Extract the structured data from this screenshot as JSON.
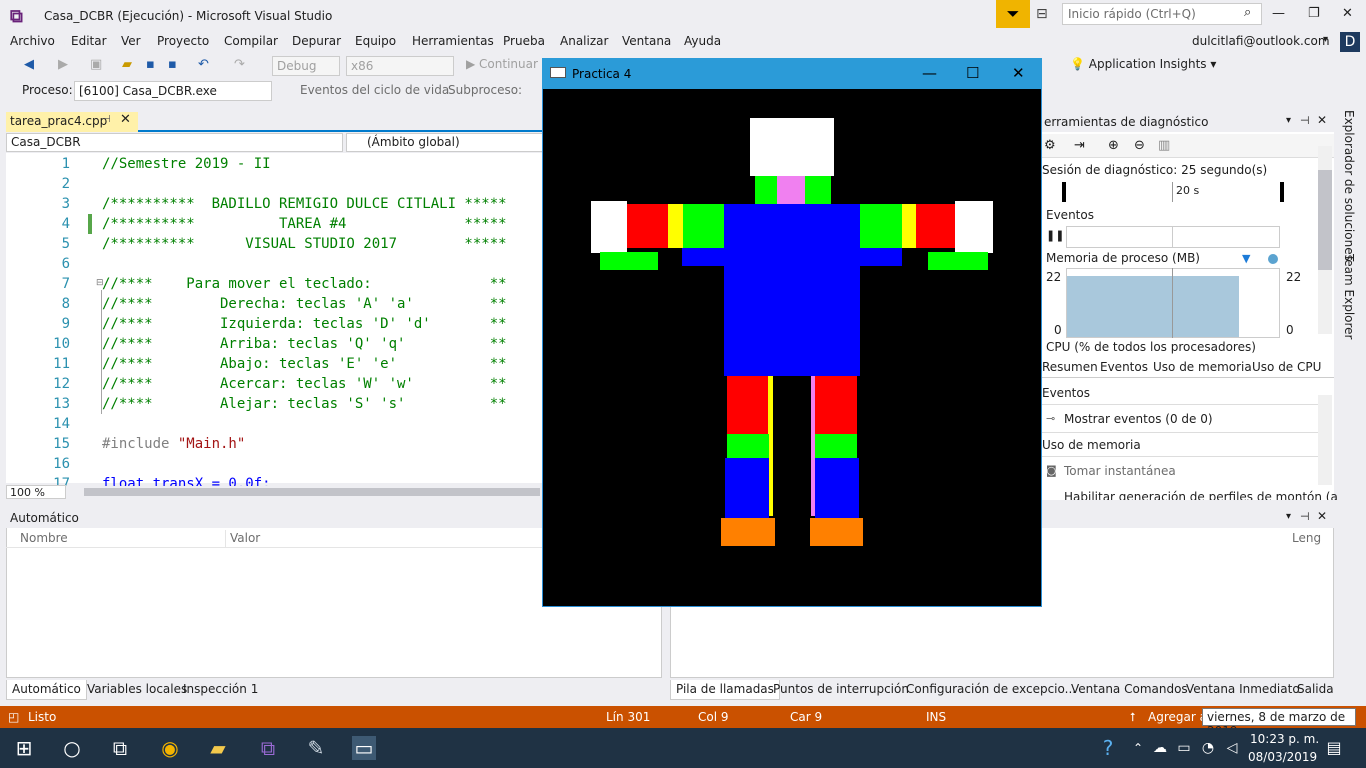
{
  "title_bar": {
    "title": "Casa_DCBR (Ejecución) - Microsoft Visual Studio",
    "quick_launch_placeholder": "Inicio rápido (Ctrl+Q)",
    "logo_glyph": "⧉",
    "notif_glyph": "⏷",
    "min_glyph": "—",
    "max_glyph": "❐",
    "close_glyph": "✕"
  },
  "menu": [
    "Archivo",
    "Editar",
    "Ver",
    "Proyecto",
    "Compilar",
    "Depurar",
    "Equipo",
    "Herramientas",
    "Prueba",
    "Analizar",
    "Ventana",
    "Ayuda"
  ],
  "account": {
    "email": "dulcitlafi@outlook.com",
    "avatar_letter": "D"
  },
  "toolbar": {
    "config": "Debug",
    "platform": "x86",
    "continue_label": "Continuar",
    "app_insights": "Application Insights"
  },
  "debug_bar": {
    "process_label": "Proceso:",
    "process_value": "[6100] Casa_DCBR.exe",
    "lifecycle_label": "Eventos del ciclo de vida",
    "subprocess_label": "Subproceso:"
  },
  "editor": {
    "tab_name": "tarea_prac4.cpp",
    "nav_project": "Casa_DCBR",
    "nav_scope": "(Ámbito global)",
    "zoom": "100 %",
    "lines": [
      {
        "n": "1",
        "text": "//Semestre 2019 - II"
      },
      {
        "n": "2",
        "text": ""
      },
      {
        "n": "3",
        "text": "/**********  BADILLO REMIGIO DULCE CITLALI *****"
      },
      {
        "n": "4",
        "text": "/**********          TAREA #4              *****"
      },
      {
        "n": "5",
        "text": "/**********      VISUAL STUDIO 2017        *****"
      },
      {
        "n": "6",
        "text": ""
      },
      {
        "n": "7",
        "text": "//****    Para mover el teclado:              **"
      },
      {
        "n": "8",
        "text": "//****        Derecha: teclas 'A' 'a'         **"
      },
      {
        "n": "9",
        "text": "//****        Izquierda: teclas 'D' 'd'       **"
      },
      {
        "n": "10",
        "text": "//****        Arriba: teclas 'Q' 'q'          **"
      },
      {
        "n": "11",
        "text": "//****        Abajo: teclas 'E' 'e'           **"
      },
      {
        "n": "12",
        "text": "//****        Acercar: teclas 'W' 'w'         **"
      },
      {
        "n": "13",
        "text": "//****        Alejar: teclas 'S' 's'          **"
      },
      {
        "n": "14",
        "text": ""
      },
      {
        "n": "15",
        "text": "#include "
      },
      {
        "n": "16",
        "text": ""
      },
      {
        "n": "17",
        "text": "float transX = 0.0f;"
      }
    ],
    "include_file": "\"Main.h\""
  },
  "auto_panel": {
    "title": "Automático",
    "col_name": "Nombre",
    "col_value": "Valor",
    "tabs": [
      "Automático",
      "Variables locales",
      "Inspección 1"
    ]
  },
  "bottom_right_tabs": [
    "Pila de llamadas",
    "Puntos de interrupción",
    "Configuración de excepcio...",
    "Ventana Comandos",
    "Ventana Inmediato",
    "Salida"
  ],
  "callstack_col": "Leng",
  "diag": {
    "title": "erramientas de diagnóstico",
    "session": "Sesión de diagnóstico: 25 segundo(s)",
    "timeline_label": "20 s",
    "events_label": "Eventos",
    "memory_label": "Memoria de proceso (MB)",
    "mem_max": "22",
    "mem_min": "0",
    "cpu_label": "CPU (% de todos los procesadores)",
    "tabs": [
      "Resumen",
      "Eventos",
      "Uso de memoria",
      "Uso de CPU"
    ],
    "sec_events": "Eventos",
    "show_events": "Mostrar eventos (0 de 0)",
    "sec_memory": "Uso de memoria",
    "snapshot": "Tomar instantánea",
    "heap": "Habilitar generación de perfiles de montón (a"
  },
  "side_tabs": [
    "Explorador de soluciones",
    "Team Explorer"
  ],
  "status": {
    "ready": "Listo",
    "line": "Lín 301",
    "col": "Col 9",
    "car": "Car 9",
    "ins": "INS",
    "add": "Agregar a",
    "date_tooltip": "viernes, 8 de marzo de 2019"
  },
  "taskbar": {
    "time": "10:23 p. m.",
    "date": "08/03/2019"
  },
  "practica": {
    "title": "Practica 4",
    "colors": {
      "white": "#ffffff",
      "green": "#00ff00",
      "pink": "#f080f0",
      "blue": "#0000ff",
      "red": "#ff0000",
      "yellow": "#ffff00",
      "orange": "#ff8000"
    }
  }
}
